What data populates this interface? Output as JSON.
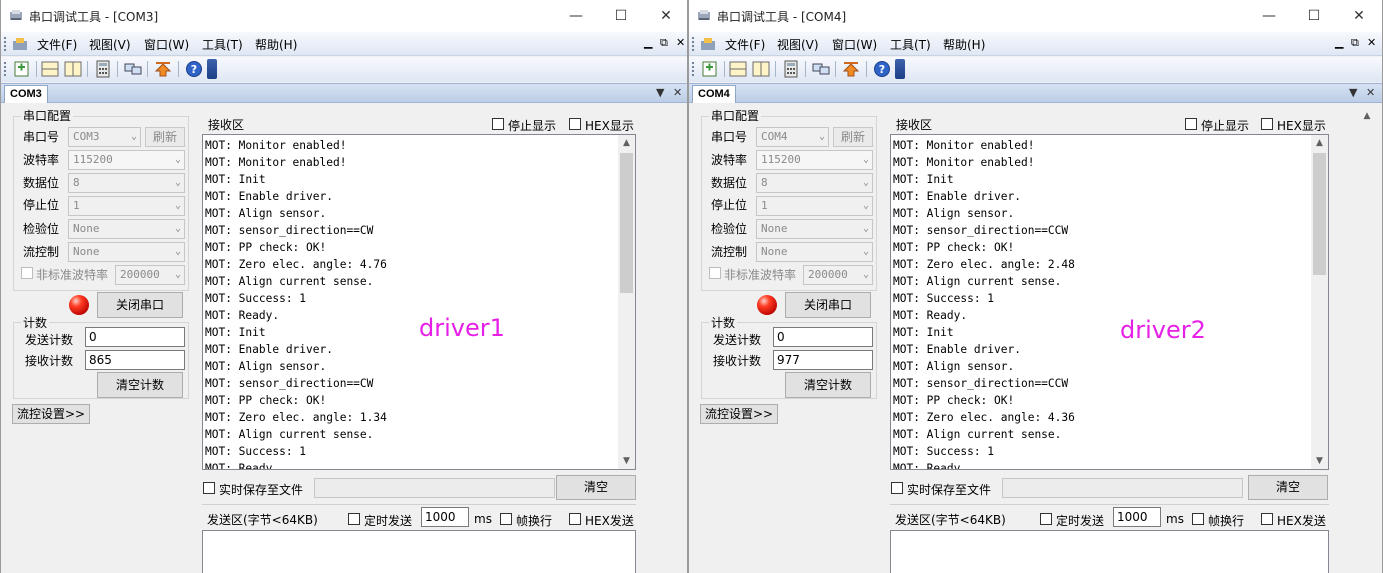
{
  "windows": [
    {
      "title": "串口调试工具 - [COM3]",
      "menu": [
        "文件(F)",
        "视图(V)",
        "窗口(W)",
        "工具(T)",
        "帮助(H)"
      ],
      "tab": "COM3",
      "serial_config": {
        "group": "串口配置",
        "port_label": "串口号",
        "port_value": "COM3",
        "refresh": "刷新",
        "baud_label": "波特率",
        "baud_value": "115200",
        "data_label": "数据位",
        "data_value": "8",
        "stop_label": "停止位",
        "stop_value": "1",
        "parity_label": "检验位",
        "parity_value": "None",
        "flow_label": "流控制",
        "flow_value": "None",
        "nonstd_label": "非标准波特率",
        "nonstd_value": "200000",
        "close_port": "关闭串口"
      },
      "counts": {
        "group": "计数",
        "send_label": "发送计数",
        "send_value": "0",
        "recv_label": "接收计数",
        "recv_value": "865",
        "clear": "清空计数"
      },
      "flow_settings": "流控设置>>",
      "recv": {
        "title": "接收区",
        "stop_display": "停止显示",
        "hex_display": "HEX显示",
        "lines": "MOT: Monitor enabled!\nMOT: Monitor enabled!\nMOT: Init\nMOT: Enable driver.\nMOT: Align sensor.\nMOT: sensor_direction==CW\nMOT: PP check: OK!\nMOT: Zero elec. angle: 4.76\nMOT: Align current sense.\nMOT: Success: 1\nMOT: Ready.\nMOT: Init\nMOT: Enable driver.\nMOT: Align sensor.\nMOT: sensor_direction==CW\nMOT: PP check: OK!\nMOT: Zero elec. angle: 1.34\nMOT: Align current sense.\nMOT: Success: 1\nMOT: Ready."
      },
      "overlay": "driver1",
      "realtime_save": "实时保存至文件",
      "clear": "清空",
      "send": {
        "title": "发送区(字节<64KB)",
        "timed": "定时发送",
        "interval": "1000",
        "unit": "ms",
        "frame": "帧换行",
        "hex_send": "HEX发送"
      }
    },
    {
      "title": "串口调试工具 - [COM4]",
      "menu": [
        "文件(F)",
        "视图(V)",
        "窗口(W)",
        "工具(T)",
        "帮助(H)"
      ],
      "tab": "COM4",
      "serial_config": {
        "group": "串口配置",
        "port_label": "串口号",
        "port_value": "COM4",
        "refresh": "刷新",
        "baud_label": "波特率",
        "baud_value": "115200",
        "data_label": "数据位",
        "data_value": "8",
        "stop_label": "停止位",
        "stop_value": "1",
        "parity_label": "检验位",
        "parity_value": "None",
        "flow_label": "流控制",
        "flow_value": "None",
        "nonstd_label": "非标准波特率",
        "nonstd_value": "200000",
        "close_port": "关闭串口"
      },
      "counts": {
        "group": "计数",
        "send_label": "发送计数",
        "send_value": "0",
        "recv_label": "接收计数",
        "recv_value": "977",
        "clear": "清空计数"
      },
      "flow_settings": "流控设置>>",
      "recv": {
        "title": "接收区",
        "stop_display": "停止显示",
        "hex_display": "HEX显示",
        "lines": "MOT: Monitor enabled!\nMOT: Monitor enabled!\nMOT: Init\nMOT: Enable driver.\nMOT: Align sensor.\nMOT: sensor_direction==CCW\nMOT: PP check: OK!\nMOT: Zero elec. angle: 2.48\nMOT: Align current sense.\nMOT: Success: 1\nMOT: Ready.\nMOT: Init\nMOT: Enable driver.\nMOT: Align sensor.\nMOT: sensor_direction==CCW\nMOT: PP check: OK!\nMOT: Zero elec. angle: 4.36\nMOT: Align current sense.\nMOT: Success: 1\nMOT: Ready."
      },
      "overlay": "driver2",
      "realtime_save": "实时保存至文件",
      "clear": "清空",
      "send": {
        "title": "发送区(字节<64KB)",
        "timed": "定时发送",
        "interval": "1000",
        "unit": "ms",
        "frame": "帧换行",
        "hex_send": "HEX发送"
      }
    }
  ],
  "colors": {
    "overlay": "#e620e6",
    "led": "#ff2a10",
    "tab_strip": "#c9d8ee"
  },
  "icons": [
    "app-icon",
    "new-icon",
    "split-h-icon",
    "split-v-icon",
    "calculator-icon",
    "network-icon",
    "upload-icon",
    "help-icon"
  ]
}
